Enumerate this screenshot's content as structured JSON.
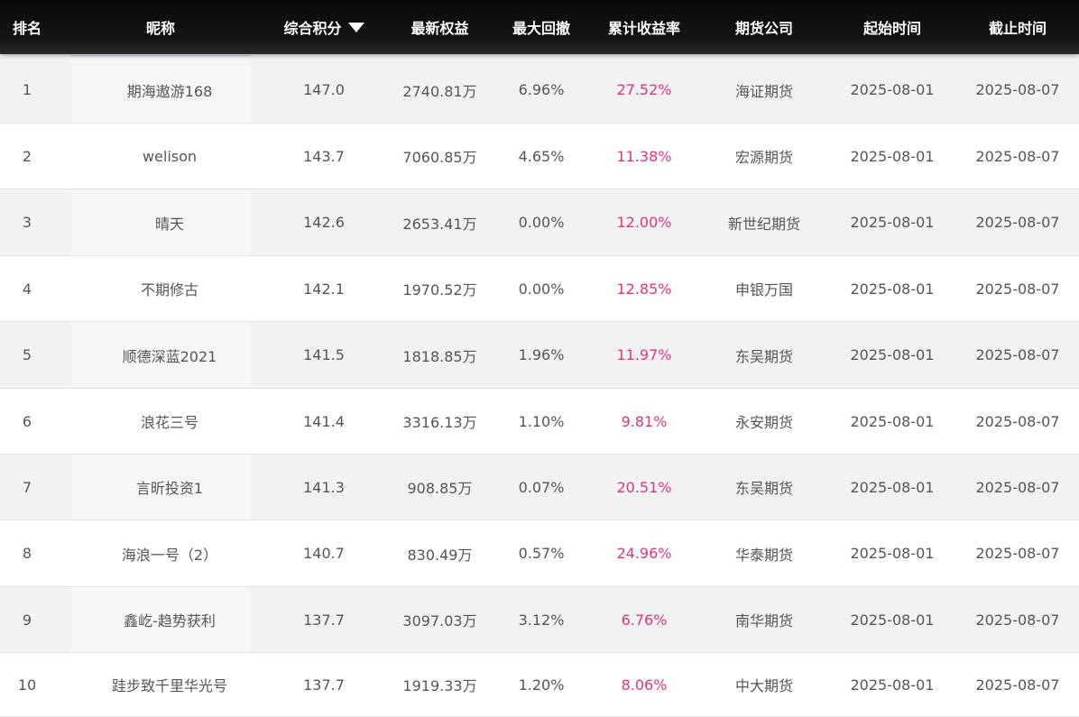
{
  "table": {
    "columns": [
      "排名",
      "昵称",
      "综合积分",
      "最新权益",
      "最大回撤",
      "累计收益率",
      "期货公司",
      "起始时间",
      "截止时间"
    ],
    "sort_column": "综合积分",
    "sort_icon": "caret-down-icon",
    "sort_direction": "desc",
    "rate_color": "#e0357a",
    "header_bg": "#111111",
    "rows": [
      {
        "rank": "1",
        "nickname": "期海遨游168",
        "score": "147.0",
        "equity": "2740.81万",
        "drawdown": "6.96%",
        "return": "27.52%",
        "company": "海证期货",
        "start": "2025-08-01",
        "end": "2025-08-07"
      },
      {
        "rank": "2",
        "nickname": "welison",
        "score": "143.7",
        "equity": "7060.85万",
        "drawdown": "4.65%",
        "return": "11.38%",
        "company": "宏源期货",
        "start": "2025-08-01",
        "end": "2025-08-07"
      },
      {
        "rank": "3",
        "nickname": "晴天",
        "score": "142.6",
        "equity": "2653.41万",
        "drawdown": "0.00%",
        "return": "12.00%",
        "company": "新世纪期货",
        "start": "2025-08-01",
        "end": "2025-08-07"
      },
      {
        "rank": "4",
        "nickname": "不期修古",
        "score": "142.1",
        "equity": "1970.52万",
        "drawdown": "0.00%",
        "return": "12.85%",
        "company": "申银万国",
        "start": "2025-08-01",
        "end": "2025-08-07"
      },
      {
        "rank": "5",
        "nickname": "顺德深蓝2021",
        "score": "141.5",
        "equity": "1818.85万",
        "drawdown": "1.96%",
        "return": "11.97%",
        "company": "东吴期货",
        "start": "2025-08-01",
        "end": "2025-08-07"
      },
      {
        "rank": "6",
        "nickname": "浪花三号",
        "score": "141.4",
        "equity": "3316.13万",
        "drawdown": "1.10%",
        "return": "9.81%",
        "company": "永安期货",
        "start": "2025-08-01",
        "end": "2025-08-07"
      },
      {
        "rank": "7",
        "nickname": "言昕投资1",
        "score": "141.3",
        "equity": "908.85万",
        "drawdown": "0.07%",
        "return": "20.51%",
        "company": "东吴期货",
        "start": "2025-08-01",
        "end": "2025-08-07"
      },
      {
        "rank": "8",
        "nickname": "海浪一号（2）",
        "score": "140.7",
        "equity": "830.49万",
        "drawdown": "0.57%",
        "return": "24.96%",
        "company": "华泰期货",
        "start": "2025-08-01",
        "end": "2025-08-07"
      },
      {
        "rank": "9",
        "nickname": "鑫屹-趋势获利",
        "score": "137.7",
        "equity": "3097.03万",
        "drawdown": "3.12%",
        "return": "6.76%",
        "company": "南华期货",
        "start": "2025-08-01",
        "end": "2025-08-07"
      },
      {
        "rank": "10",
        "nickname": "跬步致千里华光号",
        "score": "137.7",
        "equity": "1919.33万",
        "drawdown": "1.20%",
        "return": "8.06%",
        "company": "中大期货",
        "start": "2025-08-01",
        "end": "2025-08-07"
      }
    ]
  }
}
